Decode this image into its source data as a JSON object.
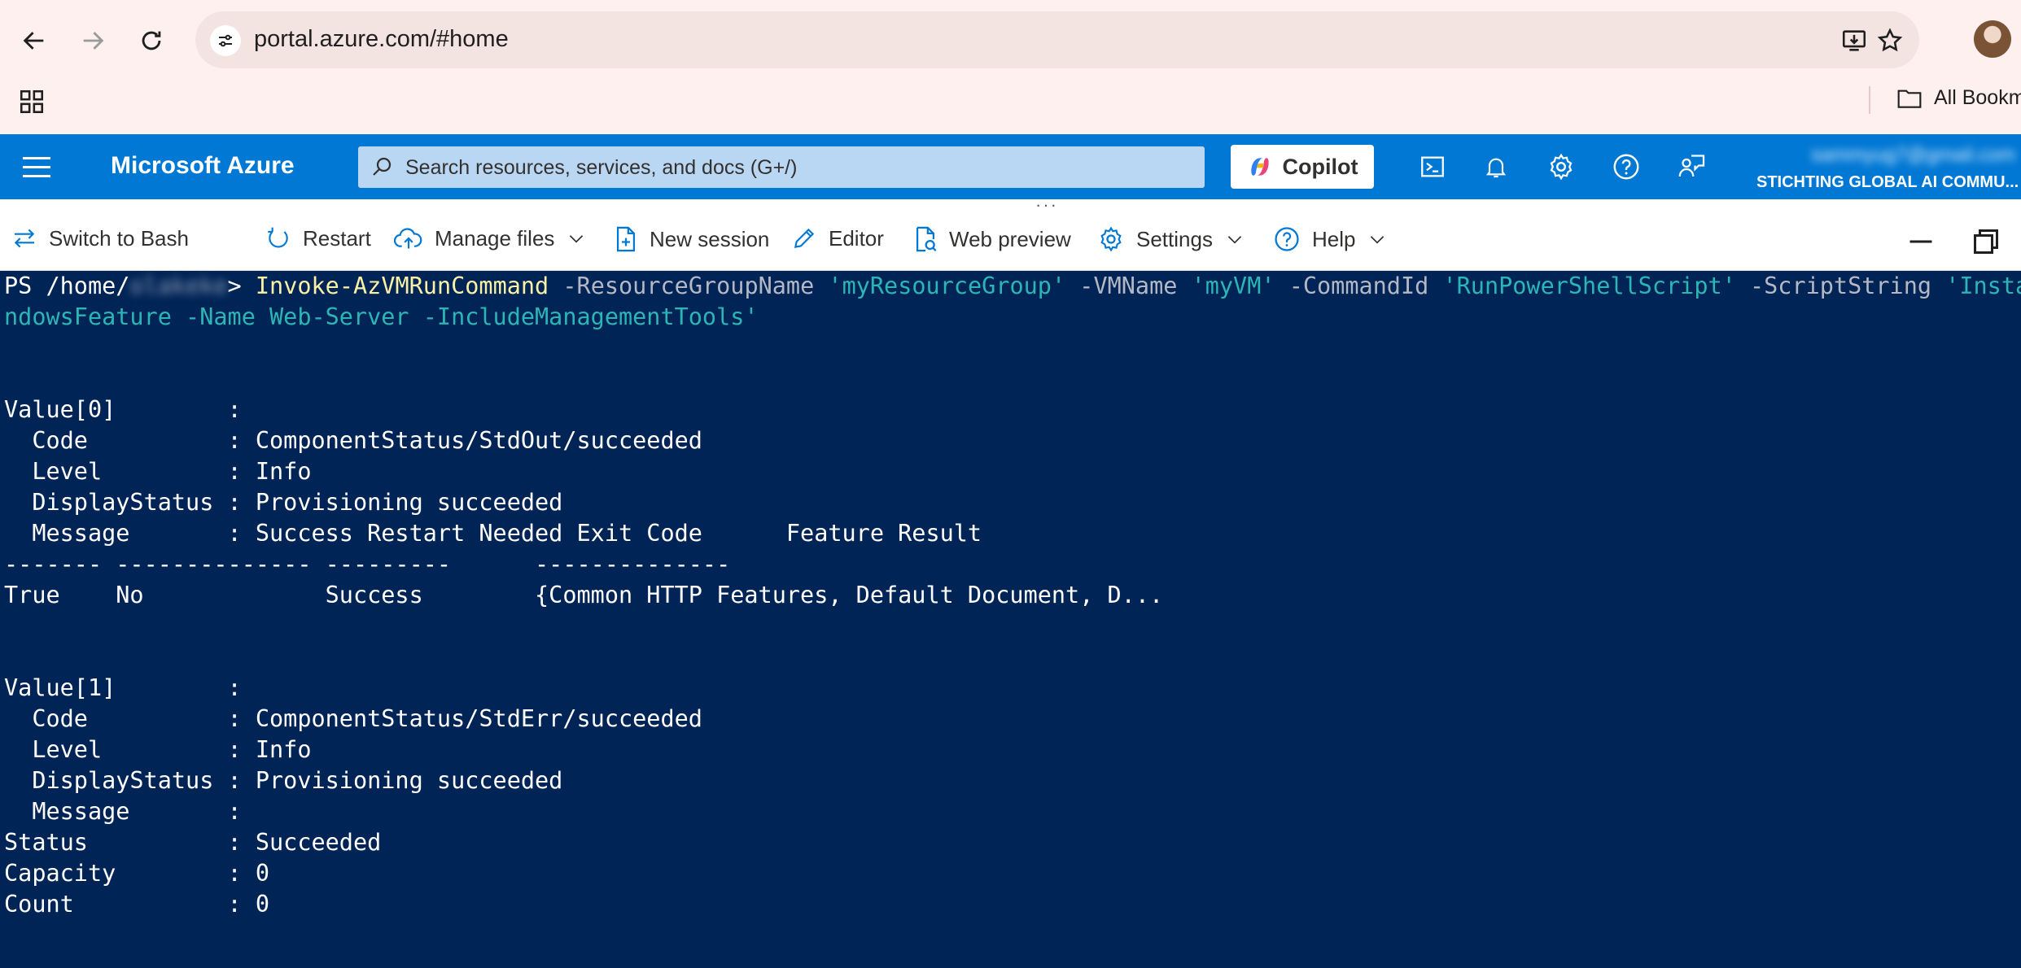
{
  "browser": {
    "url": "portal.azure.com/#home",
    "bookmarks_label": "All Bookm"
  },
  "azure": {
    "brand": "Microsoft Azure",
    "search_placeholder": "Search resources, services, and docs (G+/)",
    "copilot_label": "Copilot",
    "account_email": "sammyug7@gmail.com",
    "account_org": "STICHTING GLOBAL AI COMMU..."
  },
  "toolbar": {
    "switch_label": "Switch to Bash",
    "restart_label": "Restart",
    "manage_files_label": "Manage files",
    "new_session_label": "New session",
    "editor_label": "Editor",
    "web_preview_label": "Web preview",
    "settings_label": "Settings",
    "help_label": "Help"
  },
  "terminal": {
    "prompt_prefix": "PS /home/",
    "prompt_user": "olakeke",
    "prompt_suffix": ">",
    "cmdlet": "Invoke-AzVMRunCommand",
    "p1": "-ResourceGroupName",
    "v1": "'myResourceGroup'",
    "p2": "-VMName",
    "v2": "'myVM'",
    "p3": "-CommandId",
    "v3": "'RunPowerShellScript'",
    "p4": "-ScriptString",
    "v4a": "'Install-Wi",
    "v4b": "ndowsFeature -Name Web-Server -IncludeManagementTools'",
    "lines": [
      "Value[0]        :",
      "  Code          : ComponentStatus/StdOut/succeeded",
      "  Level         : Info",
      "  DisplayStatus : Provisioning succeeded",
      "  Message       : Success Restart Needed Exit Code      Feature Result",
      "------- -------------- ---------      --------------",
      "True    No             Success        {Common HTTP Features, Default Document, D...",
      "Value[1]        :",
      "  Code          : ComponentStatus/StdErr/succeeded",
      "  Level         : Info",
      "  DisplayStatus : Provisioning succeeded",
      "  Message       :",
      "Status          : Succeeded",
      "Capacity        : 0",
      "Count           : 0"
    ]
  },
  "colors": {
    "azure_blue": "#0078d4",
    "terminal_bg": "#012456",
    "cmdlet_yellow": "#f9f1a5",
    "string_cyan": "#2cb5b5"
  }
}
